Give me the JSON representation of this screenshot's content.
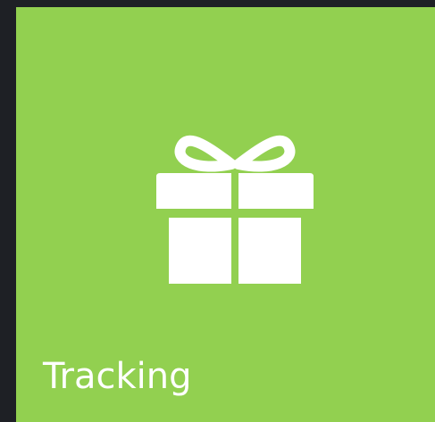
{
  "tile": {
    "label": "Tracking",
    "icon": "gift-icon",
    "background_color": "#92d050",
    "foreground_color": "#ffffff"
  }
}
